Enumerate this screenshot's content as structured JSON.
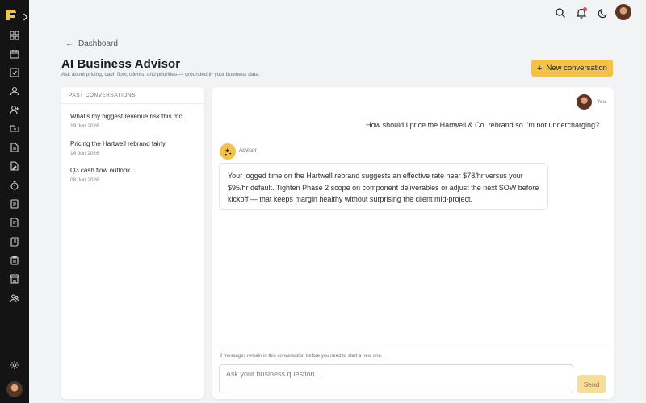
{
  "app": {
    "logo_text": "FD"
  },
  "rail": {
    "icons": [
      "dashboard-icon",
      "calendar-icon",
      "tasks-icon",
      "user-icon",
      "add-user-icon",
      "folder-icon",
      "document-icon",
      "file-edit-icon",
      "timer-icon",
      "invoice-icon",
      "note-icon",
      "scroll-icon",
      "clipboard-icon",
      "store-icon",
      "team-icon"
    ],
    "settings_icon": "gear-icon"
  },
  "header": {
    "breadcrumb": "Dashboard",
    "title": "AI Business Advisor",
    "subtitle": "Ask about pricing, cash flow, clients, and priorities — grounded in your business data.",
    "new_button": "New conversation"
  },
  "past": {
    "heading": "PAST CONVERSATIONS",
    "items": [
      {
        "title": "What's my biggest revenue risk this mo...",
        "date": "19 Jun 2026"
      },
      {
        "title": "Pricing the Hartwell rebrand fairly",
        "date": "14 Jun 2026"
      },
      {
        "title": "Q3 cash flow outlook",
        "date": "08 Jun 2026"
      }
    ]
  },
  "chat": {
    "user_label": "You",
    "user_message": "How should I price the Hartwell & Co. rebrand so I'm not undercharging?",
    "advisor_label": "Advisor",
    "advisor_message": "Your logged time on the Hartwell rebrand suggests an effective rate near $78/hr versus your $95/hr default. Tighten Phase 2 scope on component deliverables or adjust the next SOW before kickoff — that keeps margin healthy without surprising the client mid-project.",
    "remaining_note": "2 messages remain in this conversation before you need to start a new one.",
    "input_placeholder": "Ask your business question...",
    "send_label": "Send"
  },
  "colors": {
    "accent": "#f3c24a",
    "rail_bg": "#141414",
    "notification": "#e5484d"
  }
}
